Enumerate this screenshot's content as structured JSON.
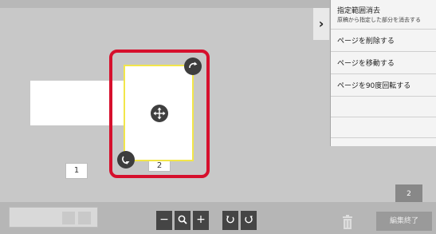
{
  "menu": {
    "items": [
      {
        "label": "指定範囲消去",
        "sub": "原稿から指定した部分を消去する"
      },
      {
        "label": "ページを削除する"
      },
      {
        "label": "ページを移動する"
      },
      {
        "label": "ページを90度回転する"
      }
    ]
  },
  "pages": {
    "left_number": "1",
    "selected_number": "2"
  },
  "page_count": "2",
  "toolbar": {
    "zoom_out": "−",
    "zoom_in": "+",
    "finish_label": "編集終了"
  },
  "icons": {
    "menu_toggle": "chevron-right-icon",
    "move": "move-arrows-icon",
    "rotate_cw": "rotate-cw-icon",
    "rotate_ccw": "rotate-ccw-icon",
    "zoom": "magnifier-icon",
    "trash": "trash-icon"
  },
  "colors": {
    "selection_frame": "#d6102d",
    "selected_page_border": "#f2e64a"
  }
}
